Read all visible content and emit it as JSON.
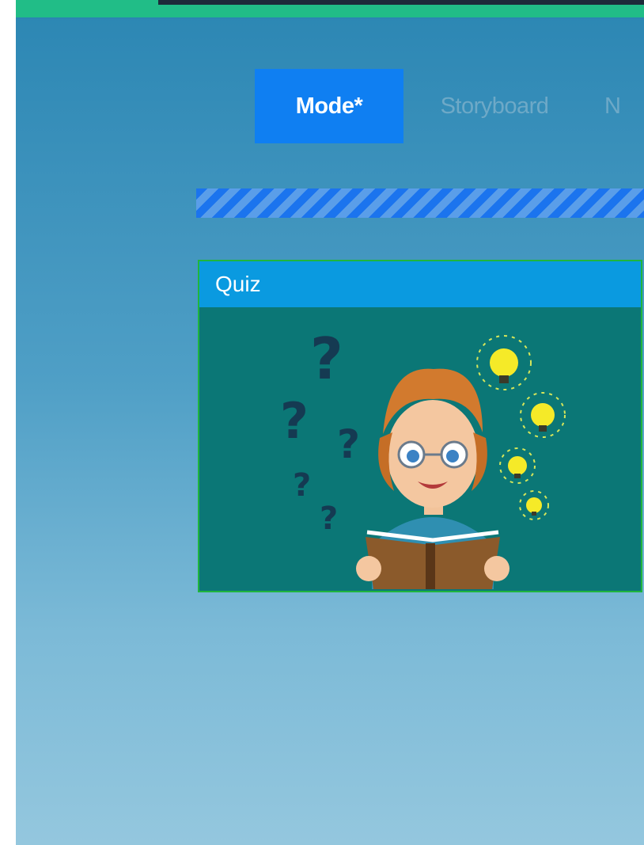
{
  "tabs": [
    {
      "label": "Mode*",
      "active": true
    },
    {
      "label": "Storyboard",
      "active": false
    },
    {
      "label": "N",
      "active": false
    }
  ],
  "progress": {
    "state": "loading-striped"
  },
  "card": {
    "title": "Quiz",
    "image_icon": "teacher-quiz-illustration"
  },
  "colors": {
    "active_tab": "#0f7ff2",
    "top_bar": "#21bd87",
    "card_header": "#0a9ae0",
    "card_border": "#1fb53d",
    "card_body": "#0b7776"
  }
}
